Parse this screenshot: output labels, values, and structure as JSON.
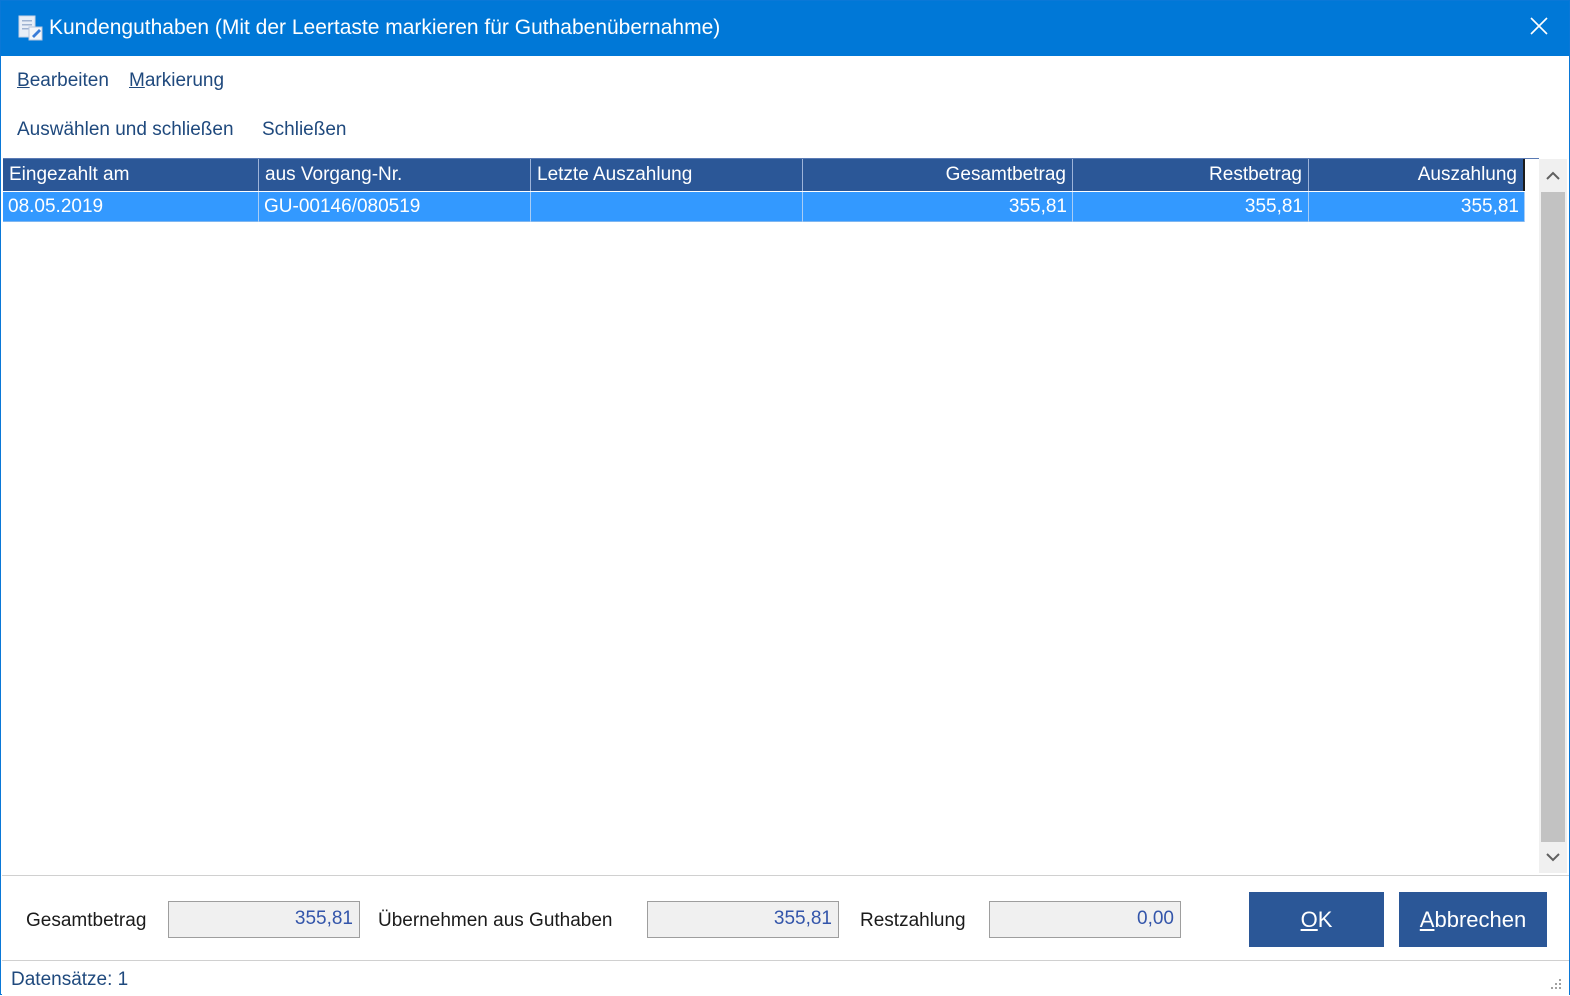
{
  "window": {
    "title": "Kundenguthaben (Mit der Leertaste markieren für Guthabenübernahme)",
    "icon": "document-edit-icon",
    "close_icon": "close-icon"
  },
  "menu": {
    "items": [
      {
        "accel": "B",
        "rest": "earbeiten"
      },
      {
        "accel": "M",
        "rest": "arkierung"
      }
    ]
  },
  "toolbar": {
    "select_close": "Auswählen und schließen",
    "close": "Schließen"
  },
  "grid": {
    "columns": [
      "Eingezahlt am",
      "aus Vorgang-Nr.",
      "Letzte Auszahlung",
      "Gesamtbetrag",
      "Restbetrag",
      "Auszahlung"
    ],
    "rows": [
      {
        "eingezahlt_am": "08.05.2019",
        "vorgang_nr": "GU-00146/080519",
        "letzte_auszahlung": "",
        "gesamtbetrag": "355,81",
        "restbetrag": "355,81",
        "auszahlung": "355,81"
      }
    ],
    "selected_row_color": "#3399ff",
    "header_color": "#2b5797"
  },
  "footer": {
    "gesamtbetrag_label": "Gesamtbetrag",
    "gesamtbetrag_value": "355,81",
    "uebernehmen_label": "Übernehmen aus Guthaben",
    "uebernehmen_value": "355,81",
    "restzahlung_label": "Restzahlung",
    "restzahlung_value": "0,00",
    "ok": {
      "accel": "O",
      "rest": "K"
    },
    "cancel": {
      "accel": "A",
      "rest": "bbrechen"
    }
  },
  "status": {
    "text": "Datensätze: 1"
  },
  "colors": {
    "titlebar": "#0078d7",
    "accent_dark": "#2b5797",
    "link_text": "#1f497d"
  }
}
